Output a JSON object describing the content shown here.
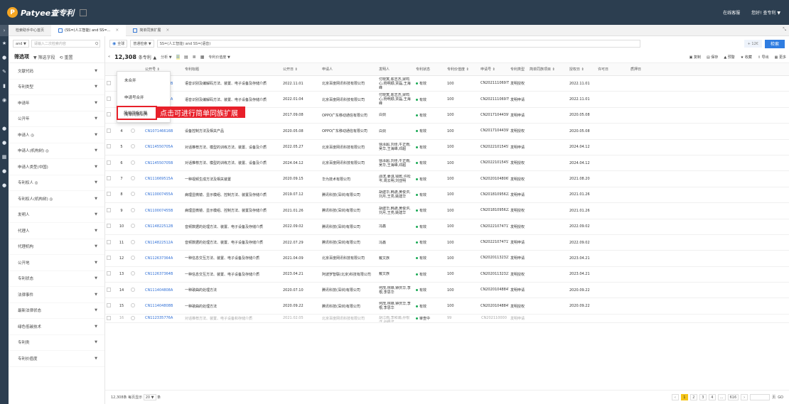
{
  "app": {
    "logo": "Patyee查专利",
    "top_right": [
      "在线客服",
      "您好! 查专利 ▼"
    ]
  },
  "rail_icons": [
    "›",
    "★",
    "●",
    "✎",
    "▮",
    "◉",
    "",
    "●",
    "●",
    "▦",
    "●",
    "●"
  ],
  "tabs": [
    {
      "label": "检索助手中心首页"
    },
    {
      "label": "(SS=(人工智能) and SS=...",
      "active": true
    },
    {
      "label": "简单同族扩展"
    }
  ],
  "left": {
    "search_mode": "and ▼",
    "search_placeholder": "请输入二次检索内容",
    "head_title": "筛选项",
    "head_opts": [
      "▼ 筛选字段",
      "⟲ 重置"
    ],
    "items": [
      "文献代码",
      "专利类型",
      "申请年",
      "公开年",
      "申请人 ◎",
      "申请人(机构树) ◎",
      "申请人类型(中国)",
      "专利权人 ◎",
      "专利权人(机构树) ◎",
      "发明人",
      "代理人",
      "代理机构",
      "公开地",
      "专利状态",
      "法律事件",
      "最新法律状态",
      "绿色低碳技术",
      "专利类",
      "专利价值度"
    ]
  },
  "searchbar": {
    "scope": "全球",
    "mode": "普通检索 ▼",
    "query": "SS=(人工智能) and SS=(语音)",
    "badge": "+ 12€",
    "button": "检索"
  },
  "toolbar": {
    "count": "12,308",
    "unit": "条专利",
    "expand": "▲",
    "opts": [
      "分析 ▼",
      "专利价值度 ▼"
    ],
    "actions": [
      "复制",
      "保存",
      "预警",
      "收藏",
      "导出",
      "更多"
    ]
  },
  "dropdown": [
    "未合并",
    "申请号合并",
    "简单同族合并",
    "简单同族扩展"
  ],
  "callout": "点击可进行简单同族扩展",
  "columns": [
    "",
    "",
    "",
    "公开号 ⇕",
    "专利标题",
    "公开日 ⇕",
    "申请人",
    "发明人",
    "专利状态",
    "专利价值度 ⇕",
    "申请号 ⇕",
    "专利类型",
    "简单同族项目 ⇕",
    "授权日 ⇕",
    "许可日",
    "质押日"
  ],
  "rows": [
    {
      "n": "1",
      "pn": "CN113889076B",
      "title": "语音识别及编解码方法、装置、电子设备及存储介质",
      "date": "2022.11.01",
      "app": "北京百度网讯科技有限公司",
      "inv": "付晓寅,陈志杰,梁鸣心,杨明顺,贾磊,王海峰",
      "st": "有效",
      "val": "100",
      "ano": "CN202111069754.9",
      "type": "发明授权",
      "grant": "2022.11.01"
    },
    {
      "n": "2",
      "pn": "CN113889076A",
      "title": "语音识别及编解码方法、装置、电子设备及存储介质",
      "date": "2022.01.04",
      "app": "北京百度网讯科技有限公司",
      "inv": "付晓寅,陈志杰,梁鸣心,杨明顺,贾磊,王海峰",
      "st": "有效",
      "val": "100",
      "ano": "CN202111069754.9",
      "type": "发明申请",
      "grant": "2022.11.01"
    },
    {
      "n": "3",
      "pn": "CN107146616A",
      "title": "设备控制方法及相关产品",
      "date": "2017.09.08",
      "app": "OPPO广东移动通信有限公司",
      "inv": "白剑",
      "st": "有效",
      "val": "100",
      "ano": "CN201710443970.2",
      "type": "发明申请",
      "grant": "2020.05.08"
    },
    {
      "n": "4",
      "pn": "CN107146616B",
      "title": "设备控制方法及相关产品",
      "date": "2020.05.08",
      "app": "OPPO广东移动通信有限公司",
      "inv": "白剑",
      "st": "有效",
      "val": "100",
      "ano": "CN201710443970.2",
      "type": "发明授权",
      "grant": "2020.05.08"
    },
    {
      "n": "5",
      "pn": "CN114550705A",
      "title": "对话推荐方法、模型的训练方法、装置、设备及介质",
      "date": "2022.05.27",
      "app": "北京百度网讯科技有限公司",
      "inv": "徐泽超,刘佳,牛正雨,吴华,王海峰,邓超",
      "st": "有效",
      "val": "100",
      "ano": "CN202210154576.8",
      "type": "发明申请",
      "grant": "2024.04.12"
    },
    {
      "n": "6",
      "pn": "CN114550705B",
      "title": "对话推荐方法、模型的训练方法、装置、设备及介质",
      "date": "2024.04.12",
      "app": "北京百度网讯科技有限公司",
      "inv": "徐泽超,刘佳,牛正雨,吴华,王海峰,邓超",
      "st": "有效",
      "val": "100",
      "ano": "CN202210154576.8",
      "type": "发明授权",
      "grant": "2024.04.12"
    },
    {
      "n": "7",
      "pn": "CN111669515A",
      "title": "一种视频生成方法及相关装置",
      "date": "2020.09.15",
      "app": "华为技术有限公司",
      "inv": "邵滨,姜淇,钱乾,许松岑,周云明,刘亚明",
      "st": "有效",
      "val": "100",
      "ano": "CN202010480675.6",
      "type": "发明授权",
      "grant": "2021.08.20"
    },
    {
      "n": "8",
      "pn": "CN110007455A",
      "title": "病理显微镜、显示模组、控制方法、装置及存储介质",
      "date": "2019.07.12",
      "app": "腾讯科技(深圳)有限公司",
      "inv": "胡建华,韩骁,黄俊洪,刘月,王亮,姚建华",
      "st": "有效",
      "val": "100",
      "ano": "CN201810956223.3",
      "type": "发明申请",
      "grant": "2021.01.26"
    },
    {
      "n": "9",
      "pn": "CN110007455B",
      "title": "病理显微镜、显示模组、控制方法、装置及存储介质",
      "date": "2021.01.26",
      "app": "腾讯科技(深圳)有限公司",
      "inv": "胡建华,韩骁,黄俊洪,刘月,王亮,姚建华",
      "st": "有效",
      "val": "100",
      "ano": "CN201810956223.3",
      "type": "发明授权",
      "grant": "2021.01.26"
    },
    {
      "n": "10",
      "pn": "CN114822512B",
      "title": "音频数据的处理方法、装置、电子设备及存储介质",
      "date": "2022.09.02",
      "app": "腾讯科技(深圳)有限公司",
      "inv": "冯鑫",
      "st": "有效",
      "val": "100",
      "ano": "CN202210747175.3",
      "type": "发明授权",
      "grant": "2022.09.02"
    },
    {
      "n": "11",
      "pn": "CN114822512A",
      "title": "音频数据的处理方法、装置、电子设备及存储介质",
      "date": "2022.07.29",
      "app": "腾讯科技(深圳)有限公司",
      "inv": "冯鑫",
      "st": "有效",
      "val": "100",
      "ano": "CN202210747175.3",
      "type": "发明申请",
      "grant": "2022.09.02"
    },
    {
      "n": "12",
      "pn": "CN112637364A",
      "title": "一种信息交互方法、装置、电子设备及存储介质",
      "date": "2021.04.09",
      "app": "北京百度网讯科技有限公司",
      "inv": "戴文族",
      "st": "有效",
      "val": "100",
      "ano": "CN202011323219.7",
      "type": "发明申请",
      "grant": "2023.04.21"
    },
    {
      "n": "13",
      "pn": "CN112637364B",
      "title": "一种信息交互方法、装置、电子设备及存储介质",
      "date": "2023.04.21",
      "app": "阿波罗智联(北京)科技有限公司",
      "inv": "戴文族",
      "st": "有效",
      "val": "100",
      "ano": "CN202011323219.7",
      "type": "发明授权",
      "grant": "2023.04.21"
    },
    {
      "n": "14",
      "pn": "CN111404808A",
      "title": "一种歌曲的处理方法",
      "date": "2020.07.10",
      "app": "腾讯科技(深圳)有限公司",
      "inv": "何茂,林锋,钟庆华,李根,李思华",
      "st": "有效",
      "val": "100",
      "ano": "CN202010488471.7",
      "type": "发明申请",
      "grant": "2020.09.22"
    },
    {
      "n": "15",
      "pn": "CN111404808B",
      "title": "一种歌曲的处理方法",
      "date": "2020.09.22",
      "app": "腾讯科技(深圳)有限公司",
      "inv": "何茂,林锋,钟庆华,李根,李思华",
      "st": "有效",
      "val": "100",
      "ano": "CN202010488471.7",
      "type": "发明授权",
      "grant": "2020.09.22"
    },
    {
      "n": "16",
      "pn": "CN112335776A",
      "title": "对话推荐方法、装置、电子设备和存储介质",
      "date": "2021.02.05",
      "app": "北京百度网讯科技有限公司",
      "inv": "胡江雨,李和瀚,孙根洋,孙根洋",
      "st": "审查中",
      "val": "99",
      "ano": "CN202110000",
      "type": "发明申请",
      "grant": ""
    }
  ],
  "footer": {
    "total": "12,308条",
    "per_page_label": "每页显示",
    "per_page": "20 ▼",
    "unit": "条",
    "pages": [
      "‹",
      "1",
      "2",
      "3",
      "4",
      "...",
      "616",
      "›"
    ],
    "current": "1",
    "goto_label": "页",
    "go": "GO"
  }
}
